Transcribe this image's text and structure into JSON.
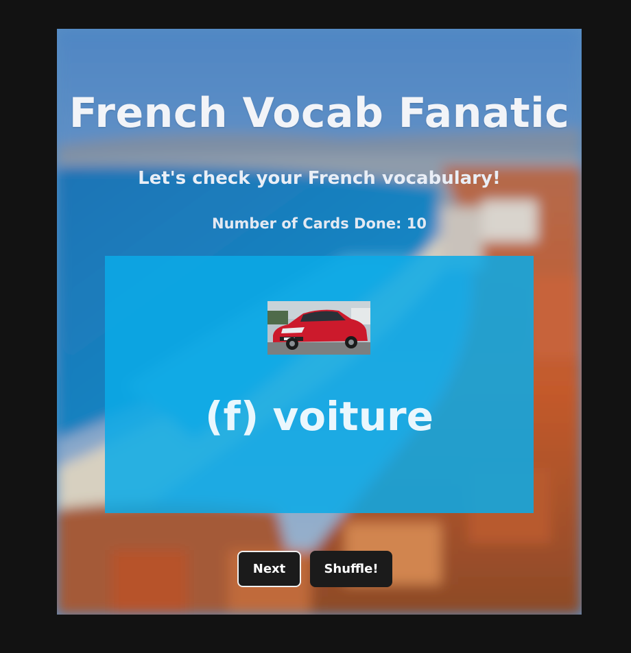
{
  "app": {
    "title": "French Vocab Fanatic",
    "subtitle": "Let's check your French vocabulary!",
    "counter_label": "Number of Cards Done: 10"
  },
  "card": {
    "word": "(f) voiture",
    "image_icon": "red-car-photo-icon"
  },
  "controls": {
    "next_label": "Next",
    "shuffle_label": "Shuffle!"
  },
  "colors": {
    "page_background": "#121212",
    "card_background": "#0baae6",
    "button_background": "#1b1b1b",
    "button_text": "#ffffff"
  }
}
